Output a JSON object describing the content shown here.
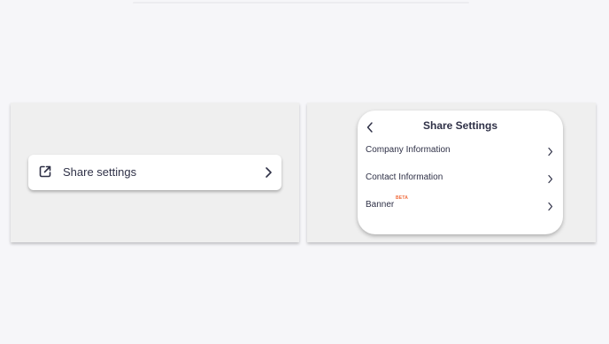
{
  "left_panel": {
    "share_button_label": "Share settings"
  },
  "share_modal": {
    "title": "Share Settings",
    "items": [
      {
        "label": "Company Information"
      },
      {
        "label": "Contact Information"
      },
      {
        "label": "Banner",
        "badge": "BETA"
      }
    ]
  },
  "colors": {
    "text": "#2f3147",
    "beta_badge": "#f16a3a",
    "panel_bg": "#efefef",
    "page_bg": "#f6f6f9"
  },
  "icons": {
    "share": "external-link-icon",
    "chevron": "chevron-right-icon",
    "back": "chevron-left-icon"
  }
}
